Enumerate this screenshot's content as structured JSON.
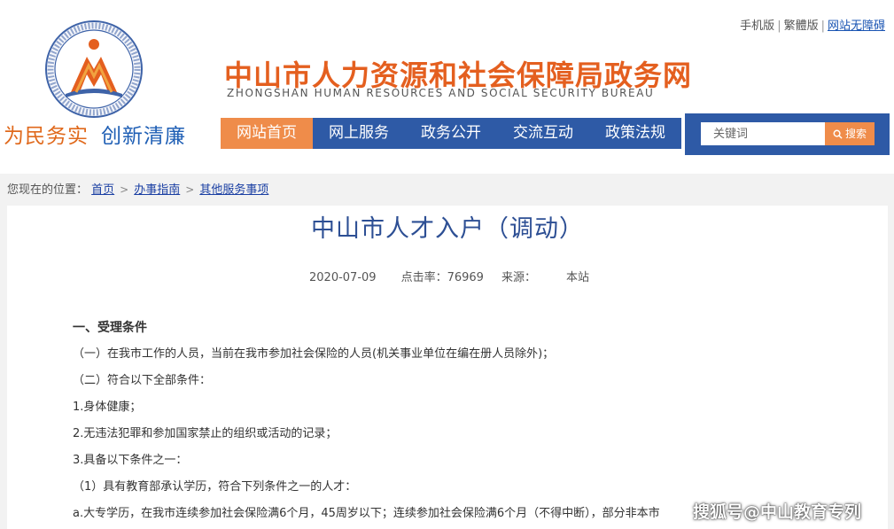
{
  "header": {
    "top_links": {
      "mobile": "手机版",
      "traditional": "繁體版",
      "accessibility": "网站无障碍"
    },
    "slogan_part1": "为民务实",
    "slogan_part2": "创新清廉",
    "site_title": "中山市人力资源和社会保障局政务网",
    "site_subtitle": "ZHONGSHAN HUMAN RESOURCES AND SOCIAL SECURITY BUREAU",
    "nav": [
      {
        "label": "网站首页"
      },
      {
        "label": "网上服务"
      },
      {
        "label": "政务公开"
      },
      {
        "label": "交流互动"
      },
      {
        "label": "政策法规"
      }
    ],
    "search": {
      "placeholder": "关键词",
      "button": "搜索"
    }
  },
  "breadcrumb": {
    "prefix": "您现在的位置：",
    "items": [
      "首页",
      "办事指南",
      "其他服务事项"
    ]
  },
  "article": {
    "title": "中山市人才入户（调动）",
    "date": "2020-07-09",
    "hits_label": "点击率：",
    "hits": "76969",
    "source_label": "来源：",
    "source": "本站",
    "paragraphs": [
      "一、受理条件",
      "（一）在我市工作的人员，当前在我市参加社会保险的人员(机关事业单位在编在册人员除外)；",
      "（二）符合以下全部条件：",
      "1.身体健康；",
      "2.无违法犯罪和参加国家禁止的组织或活动的记录；",
      "3.具备以下条件之一：",
      "（1）具有教育部承认学历，符合下列条件之一的人才：",
      "a.大专学历，在我市连续参加社会保险满6个月，45周岁以下；连续参加社会保险满6个月（不得中断），部分非本市"
    ]
  },
  "watermark": "搜狐号@中山教育专列",
  "colors": {
    "nav_blue": "#2e5aa6",
    "accent_orange": "#ef8c4a",
    "title_blue": "#2d4f94"
  }
}
